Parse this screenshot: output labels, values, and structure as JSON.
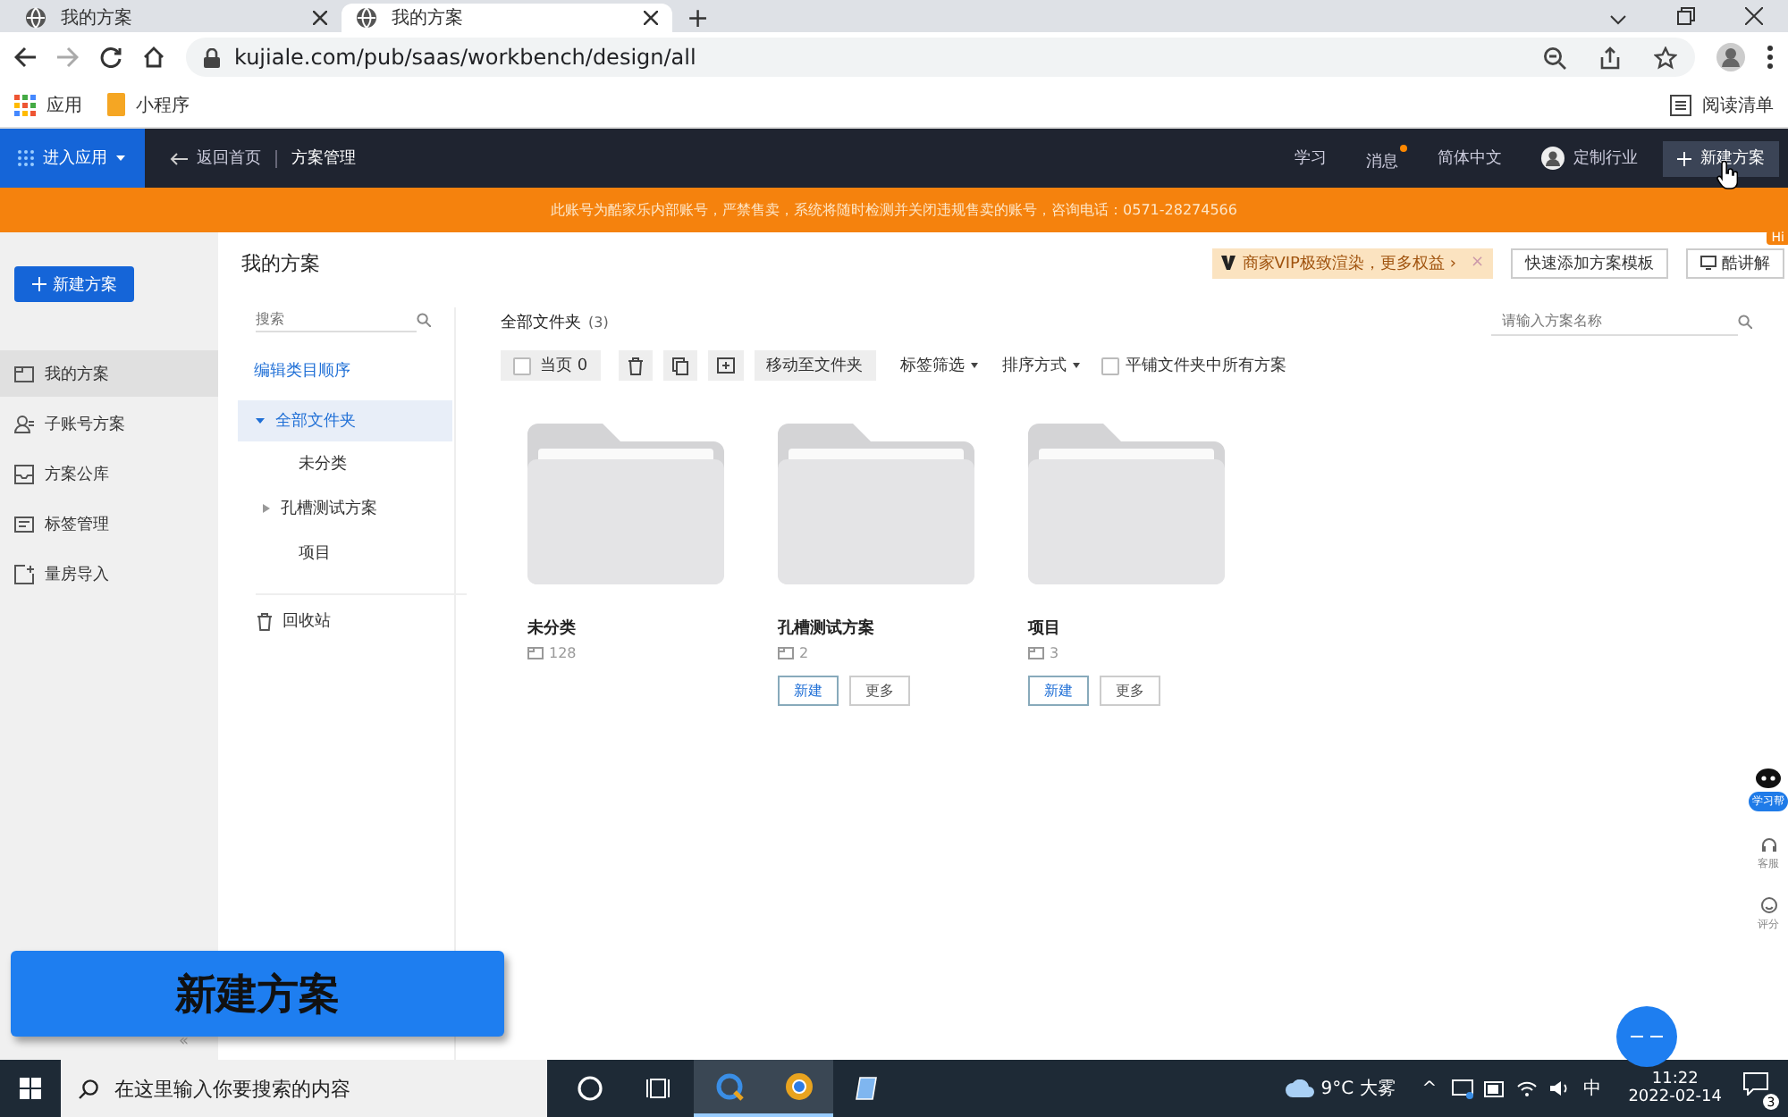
{
  "browser": {
    "tabs": [
      {
        "title": "我的方案",
        "selected": false
      },
      {
        "title": "我的方案",
        "selected": true
      }
    ],
    "new_tab": "+",
    "url": "kujiale.com/pub/saas/workbench/design/all",
    "bookmarks": [
      {
        "label": "应用",
        "kind": "apps"
      },
      {
        "label": "小程序",
        "kind": "folder"
      }
    ],
    "reading_list": "阅读清单"
  },
  "header": {
    "app_menu": "进入应用",
    "back": "返回首页",
    "breadcrumb": "方案管理",
    "nav": [
      {
        "label": "学习",
        "unread": false
      },
      {
        "label": "消息",
        "unread": true
      },
      {
        "label": "简体中文",
        "unread": false
      }
    ],
    "user": "定制行业",
    "new_button": "新建方案"
  },
  "banner": "此账号为酷家乐内部账号，严禁售卖，系统将随时检测并关闭违规售卖的账号，咨询电话：0571-28274566",
  "sidebar": {
    "new_button": "新建方案",
    "items": [
      {
        "label": "我的方案",
        "selected": true
      },
      {
        "label": "子账号方案",
        "selected": false
      },
      {
        "label": "方案公库",
        "selected": false
      },
      {
        "label": "标签管理",
        "selected": false
      },
      {
        "label": "量房导入",
        "selected": false
      }
    ]
  },
  "page_title": "我的方案",
  "top_actions": {
    "vip": "商家VIP极致渲染，更多权益 ›",
    "vip_close": "×",
    "template": "快速添加方案模板",
    "lecture": "酷讲解",
    "lecture_badge": "Hi"
  },
  "tree": {
    "search_placeholder": "搜索",
    "edit_order": "编辑类目顺序",
    "root": {
      "label": "全部文件夹",
      "expanded": true,
      "selected": true,
      "children": [
        {
          "label": "未分类",
          "has_children": false
        },
        {
          "label": "孔槽测试方案",
          "has_children": true
        },
        {
          "label": "项目",
          "has_children": false
        }
      ]
    },
    "trash": "回收站"
  },
  "content": {
    "title": "全部文件夹",
    "count": "(3)",
    "search_placeholder": "请输入方案名称",
    "select_page": {
      "label": "当页 0",
      "checked": false
    },
    "move": "移动至文件夹",
    "filters": [
      "标签筛选",
      "排序方式"
    ],
    "flatten": {
      "label": "平铺文件夹中所有方案",
      "checked": false
    },
    "folders": [
      {
        "name": "未分类",
        "count": "128"
      },
      {
        "name": "孔槽测试方案",
        "count": "2",
        "buttons": [
          "新建",
          "更多"
        ]
      },
      {
        "name": "项目",
        "count": "3",
        "buttons": [
          "新建",
          "更多"
        ]
      }
    ]
  },
  "float_tools": [
    {
      "label": "学习帮",
      "kind": "robot"
    },
    {
      "label": "客服",
      "kind": "headset"
    },
    {
      "label": "评分",
      "kind": "smile"
    }
  ],
  "caption": "新建方案",
  "collapse": "«",
  "taskbar": {
    "search": "在这里输入你要搜索的内容",
    "weather": "9°C 大雾",
    "tray_up": "^",
    "ime": "中",
    "time": "11:22",
    "date": "2022-02-14",
    "notifications": "3"
  }
}
